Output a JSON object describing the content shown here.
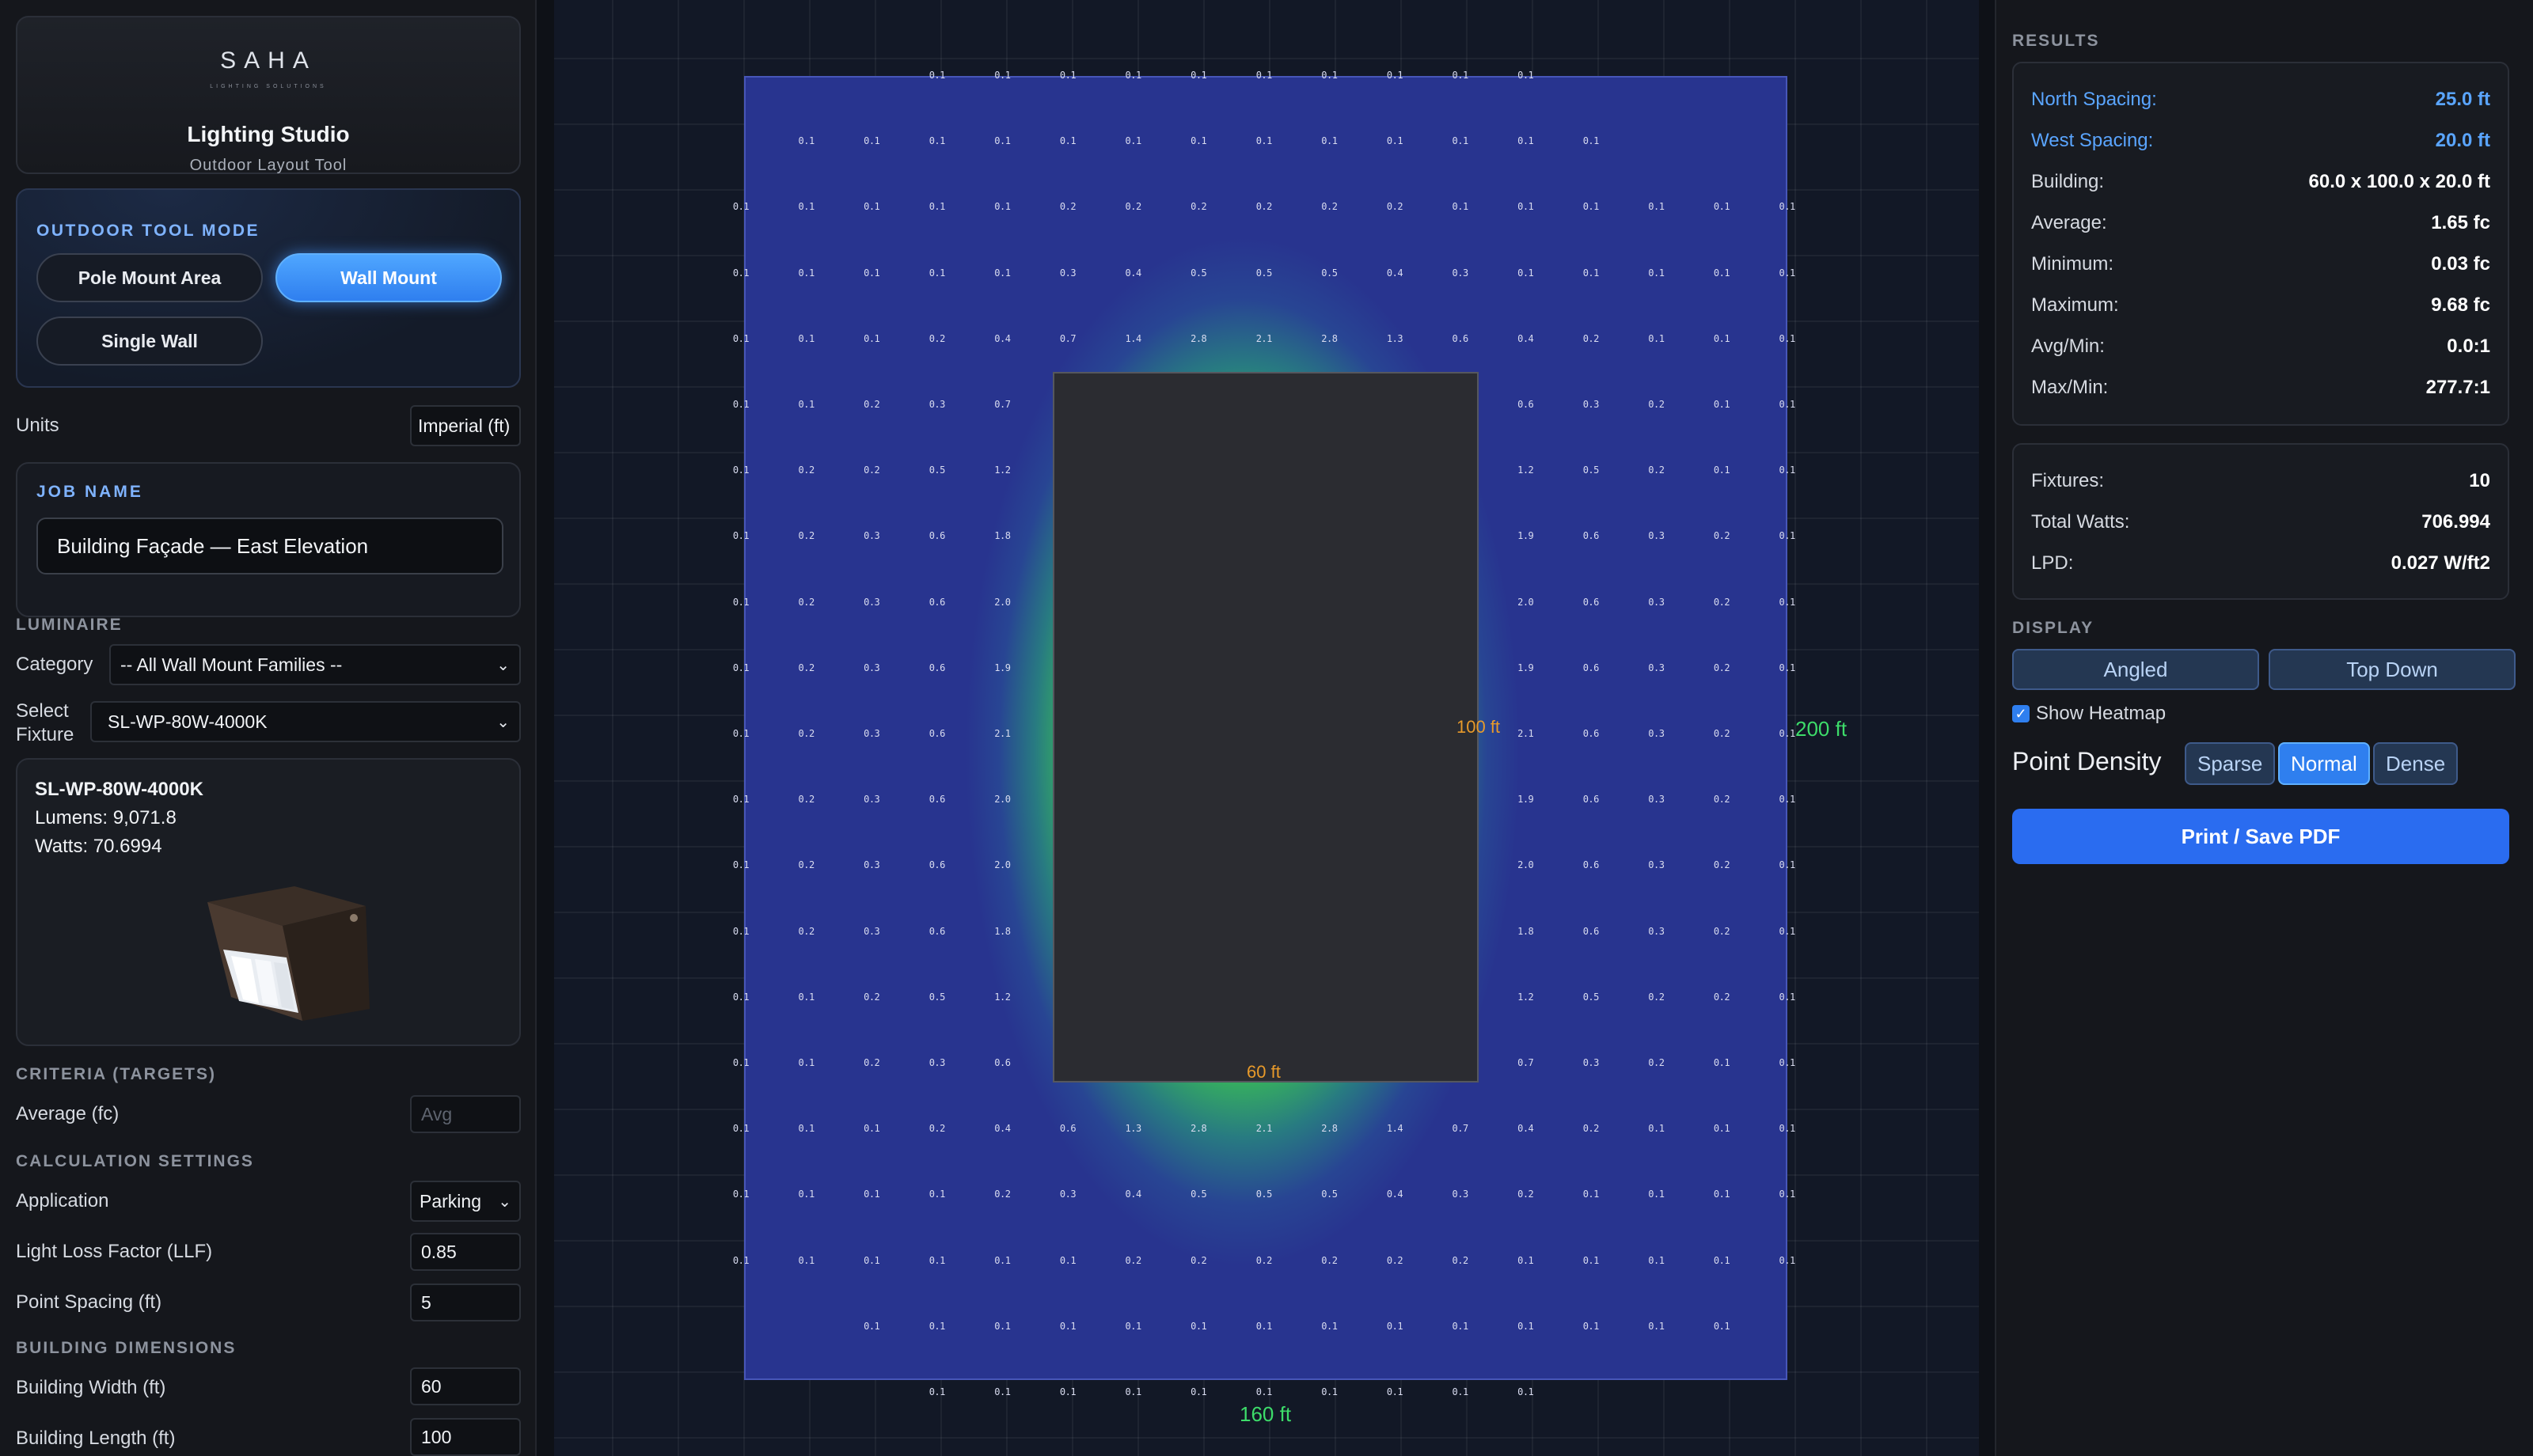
{
  "brand": {
    "logo": "SAHA",
    "logo_sub": "LIGHTING SOLUTIONS",
    "title": "Lighting Studio",
    "subtitle": "Outdoor Layout Tool"
  },
  "mode": {
    "title": "OUTDOOR TOOL MODE",
    "options": [
      "Pole Mount Area",
      "Wall Mount",
      "Single Wall"
    ],
    "active": "Wall Mount"
  },
  "units": {
    "label": "Units",
    "value": "Imperial (ft)"
  },
  "job": {
    "title": "JOB NAME",
    "value": "Building Façade — East Elevation"
  },
  "luminaire": {
    "title": "LUMINAIRE",
    "category_label": "Category",
    "category_value": "-- All Wall Mount Families --",
    "select_label_1": "Select",
    "select_label_2": "Fixture",
    "select_value": "SL-WP-80W-4000K"
  },
  "fixture": {
    "name": "SL-WP-80W-4000K",
    "lumens": "Lumens: 9,071.8",
    "watts": "Watts: 70.6994"
  },
  "criteria": {
    "title": "CRITERIA (TARGETS)",
    "avg_label": "Average (fc)",
    "avg_placeholder": "Avg"
  },
  "calc": {
    "title": "CALCULATION SETTINGS",
    "application_label": "Application",
    "application_value": "Parking",
    "llf_label": "Light Loss Factor (LLF)",
    "llf_value": "0.85",
    "spacing_label": "Point Spacing (ft)",
    "spacing_value": "5"
  },
  "building_dims": {
    "title": "BUILDING DIMENSIONS",
    "width_label": "Building Width (ft)",
    "width_value": "60",
    "length_label": "Building Length (ft)",
    "length_value": "100"
  },
  "canvas": {
    "dim_building_length": "100 ft",
    "dim_building_width": "60 ft",
    "dim_site_length": "200 ft",
    "dim_site_width": "160 ft",
    "colors": {
      "heat_low": "#28348f",
      "heat_high": "#3cc850",
      "dim_orange": "#e89a2a",
      "dim_green": "#3ddc6a"
    }
  },
  "results": {
    "title": "RESULTS",
    "rows": [
      {
        "k": "North Spacing:",
        "v": "25.0 ft",
        "accent": true
      },
      {
        "k": "West Spacing:",
        "v": "20.0 ft",
        "accent": true
      },
      {
        "k": "Building:",
        "v": "60.0 x 100.0 x 20.0 ft"
      },
      {
        "k": "Average:",
        "v": "1.65 fc"
      },
      {
        "k": "Minimum:",
        "v": "0.03 fc"
      },
      {
        "k": "Maximum:",
        "v": "9.68 fc"
      },
      {
        "k": "Avg/Min:",
        "v": "0.0:1"
      },
      {
        "k": "Max/Min:",
        "v": "277.7:1"
      }
    ],
    "summary": [
      {
        "k": "Fixtures:",
        "v": "10"
      },
      {
        "k": "Total Watts:",
        "v": "706.994"
      },
      {
        "k": "LPD:",
        "v": "0.027 W/ft2"
      }
    ]
  },
  "display": {
    "title": "DISPLAY",
    "angled": "Angled",
    "top_down": "Top Down",
    "show_heatmap": "Show Heatmap",
    "density_label": "Point Density",
    "density_options": [
      "Sparse",
      "Normal",
      "Dense"
    ],
    "density_active": "Normal"
  },
  "print_label": "Print / Save PDF",
  "grid_points": {
    "rows": [
      [
        "",
        "",
        "",
        "0.1",
        "0.1",
        "0.1",
        "0.1",
        "0.1",
        "0.1",
        "0.1",
        "0.1",
        "0.1",
        "0.1",
        "",
        "",
        "",
        ""
      ],
      [
        "",
        "0.1",
        "0.1",
        "0.1",
        "0.1",
        "0.1",
        "0.1",
        "0.1",
        "0.1",
        "0.1",
        "0.1",
        "0.1",
        "0.1",
        "0.1",
        "",
        "",
        ""
      ],
      [
        "0.1",
        "0.1",
        "0.1",
        "0.1",
        "0.1",
        "0.2",
        "0.2",
        "0.2",
        "0.2",
        "0.2",
        "0.2",
        "0.1",
        "0.1",
        "0.1",
        "0.1",
        "0.1",
        "0.1"
      ],
      [
        "0.1",
        "0.1",
        "0.1",
        "0.1",
        "0.1",
        "0.3",
        "0.4",
        "0.5",
        "0.5",
        "0.5",
        "0.4",
        "0.3",
        "0.1",
        "0.1",
        "0.1",
        "0.1",
        "0.1"
      ],
      [
        "0.1",
        "0.1",
        "0.1",
        "0.2",
        "0.4",
        "0.7",
        "1.4",
        "2.8",
        "2.1",
        "2.8",
        "1.3",
        "0.6",
        "0.4",
        "0.2",
        "0.1",
        "0.1",
        "0.1"
      ],
      [
        "0.1",
        "0.1",
        "0.2",
        "0.3",
        "0.7",
        "",
        "",
        "",
        "",
        "",
        "",
        "",
        "0.6",
        "0.3",
        "0.2",
        "0.1",
        "0.1"
      ],
      [
        "0.1",
        "0.2",
        "0.2",
        "0.5",
        "1.2",
        "",
        "",
        "",
        "",
        "",
        "",
        "",
        "1.2",
        "0.5",
        "0.2",
        "0.1",
        "0.1"
      ],
      [
        "0.1",
        "0.2",
        "0.3",
        "0.6",
        "1.8",
        "",
        "",
        "",
        "",
        "",
        "",
        "",
        "1.9",
        "0.6",
        "0.3",
        "0.2",
        "0.1"
      ],
      [
        "0.1",
        "0.2",
        "0.3",
        "0.6",
        "2.0",
        "",
        "",
        "",
        "",
        "",
        "",
        "",
        "2.0",
        "0.6",
        "0.3",
        "0.2",
        "0.1"
      ],
      [
        "0.1",
        "0.2",
        "0.3",
        "0.6",
        "1.9",
        "",
        "",
        "",
        "",
        "",
        "",
        "",
        "1.9",
        "0.6",
        "0.3",
        "0.2",
        "0.1"
      ],
      [
        "0.1",
        "0.2",
        "0.3",
        "0.6",
        "2.1",
        "",
        "",
        "",
        "",
        "",
        "",
        "",
        "2.1",
        "0.6",
        "0.3",
        "0.2",
        "0.1"
      ],
      [
        "0.1",
        "0.2",
        "0.3",
        "0.6",
        "2.0",
        "",
        "",
        "",
        "",
        "",
        "",
        "",
        "1.9",
        "0.6",
        "0.3",
        "0.2",
        "0.1"
      ],
      [
        "0.1",
        "0.2",
        "0.3",
        "0.6",
        "2.0",
        "",
        "",
        "",
        "",
        "",
        "",
        "",
        "2.0",
        "0.6",
        "0.3",
        "0.2",
        "0.1"
      ],
      [
        "0.1",
        "0.2",
        "0.3",
        "0.6",
        "1.8",
        "",
        "",
        "",
        "",
        "",
        "",
        "",
        "1.8",
        "0.6",
        "0.3",
        "0.2",
        "0.1"
      ],
      [
        "0.1",
        "0.1",
        "0.2",
        "0.5",
        "1.2",
        "",
        "",
        "",
        "",
        "",
        "",
        "",
        "1.2",
        "0.5",
        "0.2",
        "0.2",
        "0.1"
      ],
      [
        "0.1",
        "0.1",
        "0.2",
        "0.3",
        "0.6",
        "",
        "",
        "",
        "",
        "",
        "",
        "",
        "0.7",
        "0.3",
        "0.2",
        "0.1",
        "0.1"
      ],
      [
        "0.1",
        "0.1",
        "0.1",
        "0.2",
        "0.4",
        "0.6",
        "1.3",
        "2.8",
        "2.1",
        "2.8",
        "1.4",
        "0.7",
        "0.4",
        "0.2",
        "0.1",
        "0.1",
        "0.1"
      ],
      [
        "0.1",
        "0.1",
        "0.1",
        "0.1",
        "0.2",
        "0.3",
        "0.4",
        "0.5",
        "0.5",
        "0.5",
        "0.4",
        "0.3",
        "0.2",
        "0.1",
        "0.1",
        "0.1",
        "0.1"
      ],
      [
        "0.1",
        "0.1",
        "0.1",
        "0.1",
        "0.1",
        "0.1",
        "0.2",
        "0.2",
        "0.2",
        "0.2",
        "0.2",
        "0.2",
        "0.1",
        "0.1",
        "0.1",
        "0.1",
        "0.1"
      ],
      [
        "",
        "",
        "0.1",
        "0.1",
        "0.1",
        "0.1",
        "0.1",
        "0.1",
        "0.1",
        "0.1",
        "0.1",
        "0.1",
        "0.1",
        "0.1",
        "0.1",
        "0.1",
        ""
      ],
      [
        "",
        "",
        "",
        "0.1",
        "0.1",
        "0.1",
        "0.1",
        "0.1",
        "0.1",
        "0.1",
        "0.1",
        "0.1",
        "0.1",
        "",
        "",
        "",
        ""
      ]
    ]
  }
}
